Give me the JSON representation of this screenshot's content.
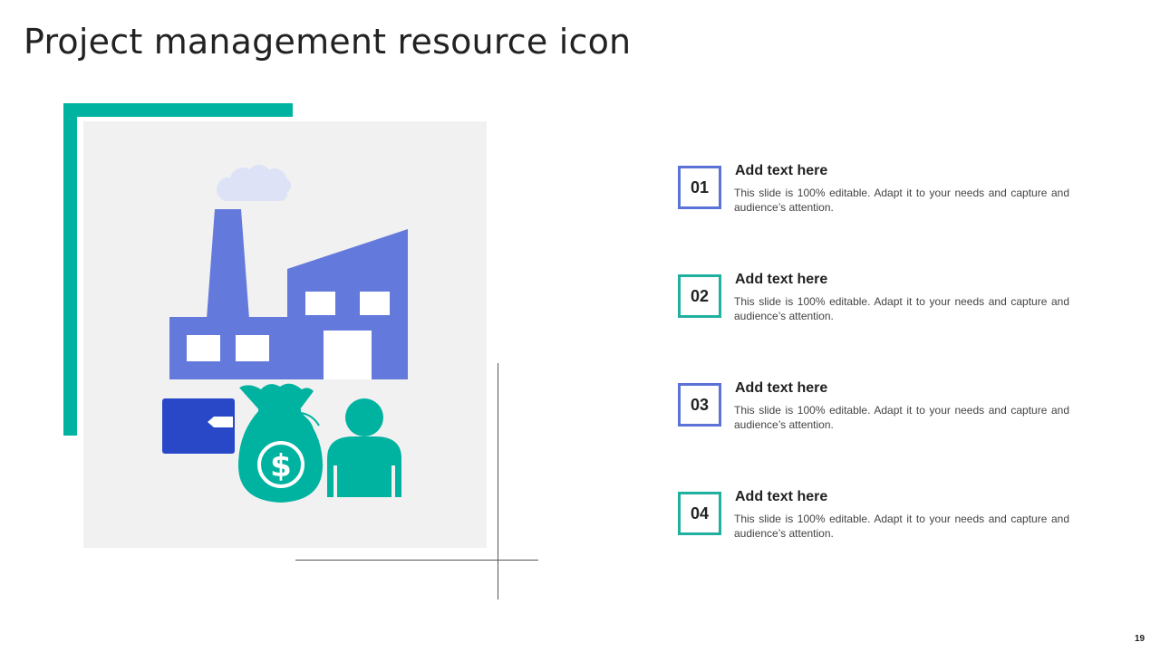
{
  "slide": {
    "title": "Project management resource icon",
    "page_number": "19"
  },
  "colors": {
    "accent_teal": "#00b3a1",
    "factory_blue": "#6479dc",
    "wallet_blue": "#2848c8",
    "panel_gray": "#f1f1f1"
  },
  "items": [
    {
      "number": "01",
      "heading": "Add text here",
      "body": "This slide is 100% editable. Adapt it to your needs and capture and audience’s attention.",
      "box_color": "blue"
    },
    {
      "number": "02",
      "heading": "Add text here",
      "body": "This slide is 100% editable. Adapt it to your needs and capture and audience’s attention.",
      "box_color": "teal"
    },
    {
      "number": "03",
      "heading": "Add text here",
      "body": "This slide is 100% editable. Adapt it to your needs and capture and audience’s attention.",
      "box_color": "blue"
    },
    {
      "number": "04",
      "heading": "Add text here",
      "body": "This slide is 100% editable. Adapt it to your needs and capture and audience’s attention.",
      "box_color": "teal"
    }
  ],
  "icons": [
    "factory-icon",
    "wallet-icon",
    "money-bag-icon",
    "person-icon"
  ]
}
